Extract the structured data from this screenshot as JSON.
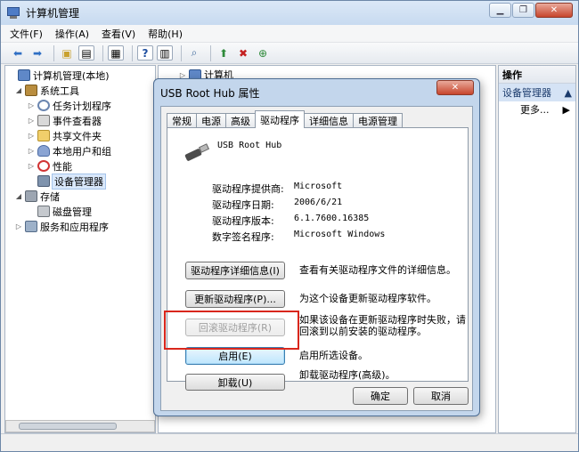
{
  "window": {
    "title": "计算机管理"
  },
  "menu": [
    "文件(F)",
    "操作(A)",
    "查看(V)",
    "帮助(H)"
  ],
  "tree": {
    "root": "计算机管理(本地)",
    "system_tools": "系统工具",
    "task_scheduler": "任务计划程序",
    "event_viewer": "事件查看器",
    "shared_folders": "共享文件夹",
    "local_users": "本地用户和组",
    "performance": "性能",
    "device_manager": "设备管理器",
    "storage": "存储",
    "disk_management": "磁盘管理",
    "services": "服务和应用程序"
  },
  "middle": {
    "top_item": "计算机"
  },
  "actions": {
    "header": "操作",
    "section": "设备管理器",
    "more": "更多..."
  },
  "dialog": {
    "title": "USB Root Hub 属性",
    "tabs": [
      "常规",
      "电源",
      "高级",
      "驱动程序",
      "详细信息",
      "电源管理"
    ],
    "active_tab": "驱动程序",
    "device_name": "USB Root Hub",
    "info": [
      {
        "key": "驱动程序提供商:",
        "value": "Microsoft"
      },
      {
        "key": "驱动程序日期:",
        "value": "2006/6/21"
      },
      {
        "key": "驱动程序版本:",
        "value": "6.1.7600.16385"
      },
      {
        "key": "数字签名程序:",
        "value": "Microsoft Windows"
      }
    ],
    "buttons": {
      "details": "驱动程序详细信息(I)",
      "update": "更新驱动程序(P)...",
      "rollback": "回滚驱动程序(R)",
      "enable": "启用(E)",
      "uninstall": "卸载(U)",
      "ok": "确定",
      "cancel": "取消"
    },
    "descriptions": {
      "details": "查看有关驱动程序文件的详细信息。",
      "update": "为这个设备更新驱动程序软件。",
      "rollback_line1": "如果该设备在更新驱动程序时失败，请",
      "rollback_line2": "回滚到以前安装的驱动程序。",
      "enable": "启用所选设备。",
      "uninstall": "卸载驱动程序(高级)。"
    }
  },
  "colors": {
    "highlight_box": "#d9261c",
    "title_gradient": "#c7daf0",
    "close_button": "#c7452c"
  }
}
